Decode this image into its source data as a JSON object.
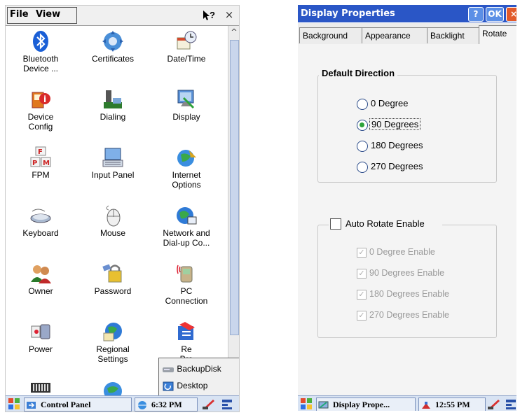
{
  "left": {
    "menu": {
      "file": "File",
      "view": "View"
    },
    "help_label": "?",
    "close_label": "×",
    "items": [
      {
        "label": "Bluetooth\nDevice ...",
        "icon": "bluetooth-icon"
      },
      {
        "label": "Certificates",
        "icon": "certificates-icon"
      },
      {
        "label": "Date/Time",
        "icon": "date-time-icon"
      },
      {
        "label": "Device\nConfig",
        "icon": "device-config-icon"
      },
      {
        "label": "Dialing",
        "icon": "dialing-icon"
      },
      {
        "label": "Display",
        "icon": "display-icon"
      },
      {
        "label": "FPM",
        "icon": "fpm-icon"
      },
      {
        "label": "Input Panel",
        "icon": "input-panel-icon"
      },
      {
        "label": "Internet\nOptions",
        "icon": "internet-options-icon"
      },
      {
        "label": "Keyboard",
        "icon": "keyboard-icon"
      },
      {
        "label": "Mouse",
        "icon": "mouse-icon"
      },
      {
        "label": "Network and\nDial-up Co...",
        "icon": "network-icon"
      },
      {
        "label": "Owner",
        "icon": "owner-icon"
      },
      {
        "label": "Password",
        "icon": "password-icon"
      },
      {
        "label": "PC\nConnection",
        "icon": "pc-connection-icon"
      },
      {
        "label": "Power",
        "icon": "power-icon"
      },
      {
        "label": "Regional\nSettings",
        "icon": "regional-settings-icon"
      },
      {
        "label": "Re\nPro",
        "icon": "remove-programs-icon"
      }
    ],
    "popup": [
      "BackupDisk",
      "Desktop"
    ],
    "taskbar": {
      "task": "Control Panel",
      "time": "6:32 PM"
    }
  },
  "right": {
    "title": "Display Properties",
    "help_label": "?",
    "ok_label": "OK",
    "close_label": "×",
    "tabs": [
      "Background",
      "Appearance",
      "Backlight",
      "Rotate"
    ],
    "active_tab": "Rotate",
    "default_direction": {
      "title": "Default Direction",
      "options": [
        "0 Degree",
        "90 Degrees",
        "180 Degrees",
        "270 Degrees"
      ],
      "selected": "90 Degrees"
    },
    "auto_rotate": {
      "label": "Auto Rotate Enable",
      "checked": false,
      "options": [
        "0 Degree Enable",
        "90 Degrees Enable",
        "180 Degrees Enable",
        "270 Degrees Enable"
      ]
    },
    "taskbar": {
      "task": "Display Prope...",
      "time": "12:55 PM"
    }
  },
  "colors": {
    "titlebar": "#2a56c6",
    "taskbar": "#d8e3f3",
    "radio_checked": "#2ea33a"
  }
}
